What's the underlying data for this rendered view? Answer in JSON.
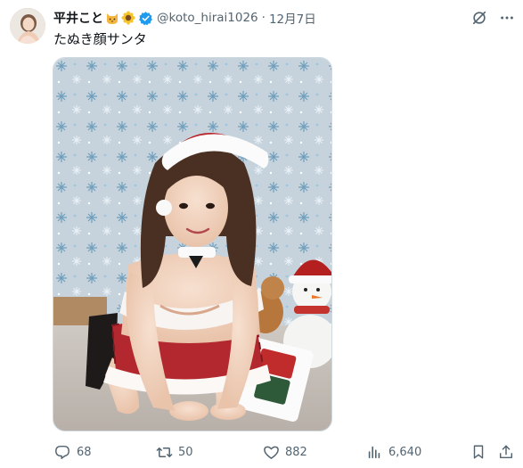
{
  "tweet": {
    "author": {
      "display_name": "平井こと",
      "emojis": [
        "cat-face",
        "sunflower"
      ],
      "verified": true,
      "handle": "@koto_hirai1026"
    },
    "separator": "·",
    "date": "12月7日",
    "text": "たぬき顔サンタ",
    "media_description_icon": "santa-cosplay-photo"
  },
  "actions": {
    "replies": "68",
    "reposts": "50",
    "likes": "882",
    "views": "6,640"
  },
  "icons": {
    "grok": "grok-icon",
    "more": "more-icon",
    "reply": "reply-icon",
    "repost": "repost-icon",
    "like": "like-icon",
    "views": "views-icon",
    "bookmark": "bookmark-icon",
    "share": "share-icon"
  },
  "colors": {
    "text_primary": "#0f1419",
    "text_secondary": "#536471",
    "verified_blue": "#1d9bf0"
  }
}
